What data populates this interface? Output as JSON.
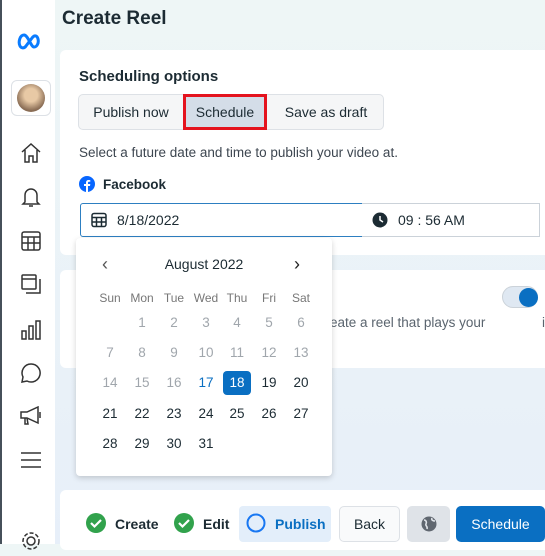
{
  "header": {
    "title": "Create Reel"
  },
  "sidebar": {
    "items": [
      "meta-logo",
      "avatar",
      "home",
      "notifications",
      "planner",
      "content",
      "insights",
      "inbox",
      "ads",
      "menu",
      "settings"
    ]
  },
  "scheduling": {
    "title": "Scheduling options",
    "options": [
      "Publish now",
      "Schedule",
      "Save as draft"
    ],
    "selected": "Schedule",
    "description": "Select a future date and time to publish your video at.",
    "platform": "Facebook",
    "date": "8/18/2022",
    "time": "09 : 56 AM"
  },
  "calendar": {
    "month": "August 2022",
    "weekdays": [
      "Sun",
      "Mon",
      "Tue",
      "Wed",
      "Thu",
      "Fri",
      "Sat"
    ],
    "start_weekday": 1,
    "days": 31,
    "today": 17,
    "selected": 18
  },
  "crosspost": {
    "text": "eate a reel that plays your",
    "trailing": "i",
    "toggle_on": true
  },
  "footer": {
    "steps": [
      {
        "label": "Create",
        "done": true
      },
      {
        "label": "Edit",
        "done": true
      },
      {
        "label": "Publish",
        "done": false
      }
    ],
    "back": "Back",
    "schedule": "Schedule"
  },
  "colors": {
    "accent": "#0a6fc2",
    "highlight": "#e4131e",
    "success": "#31a24c"
  }
}
